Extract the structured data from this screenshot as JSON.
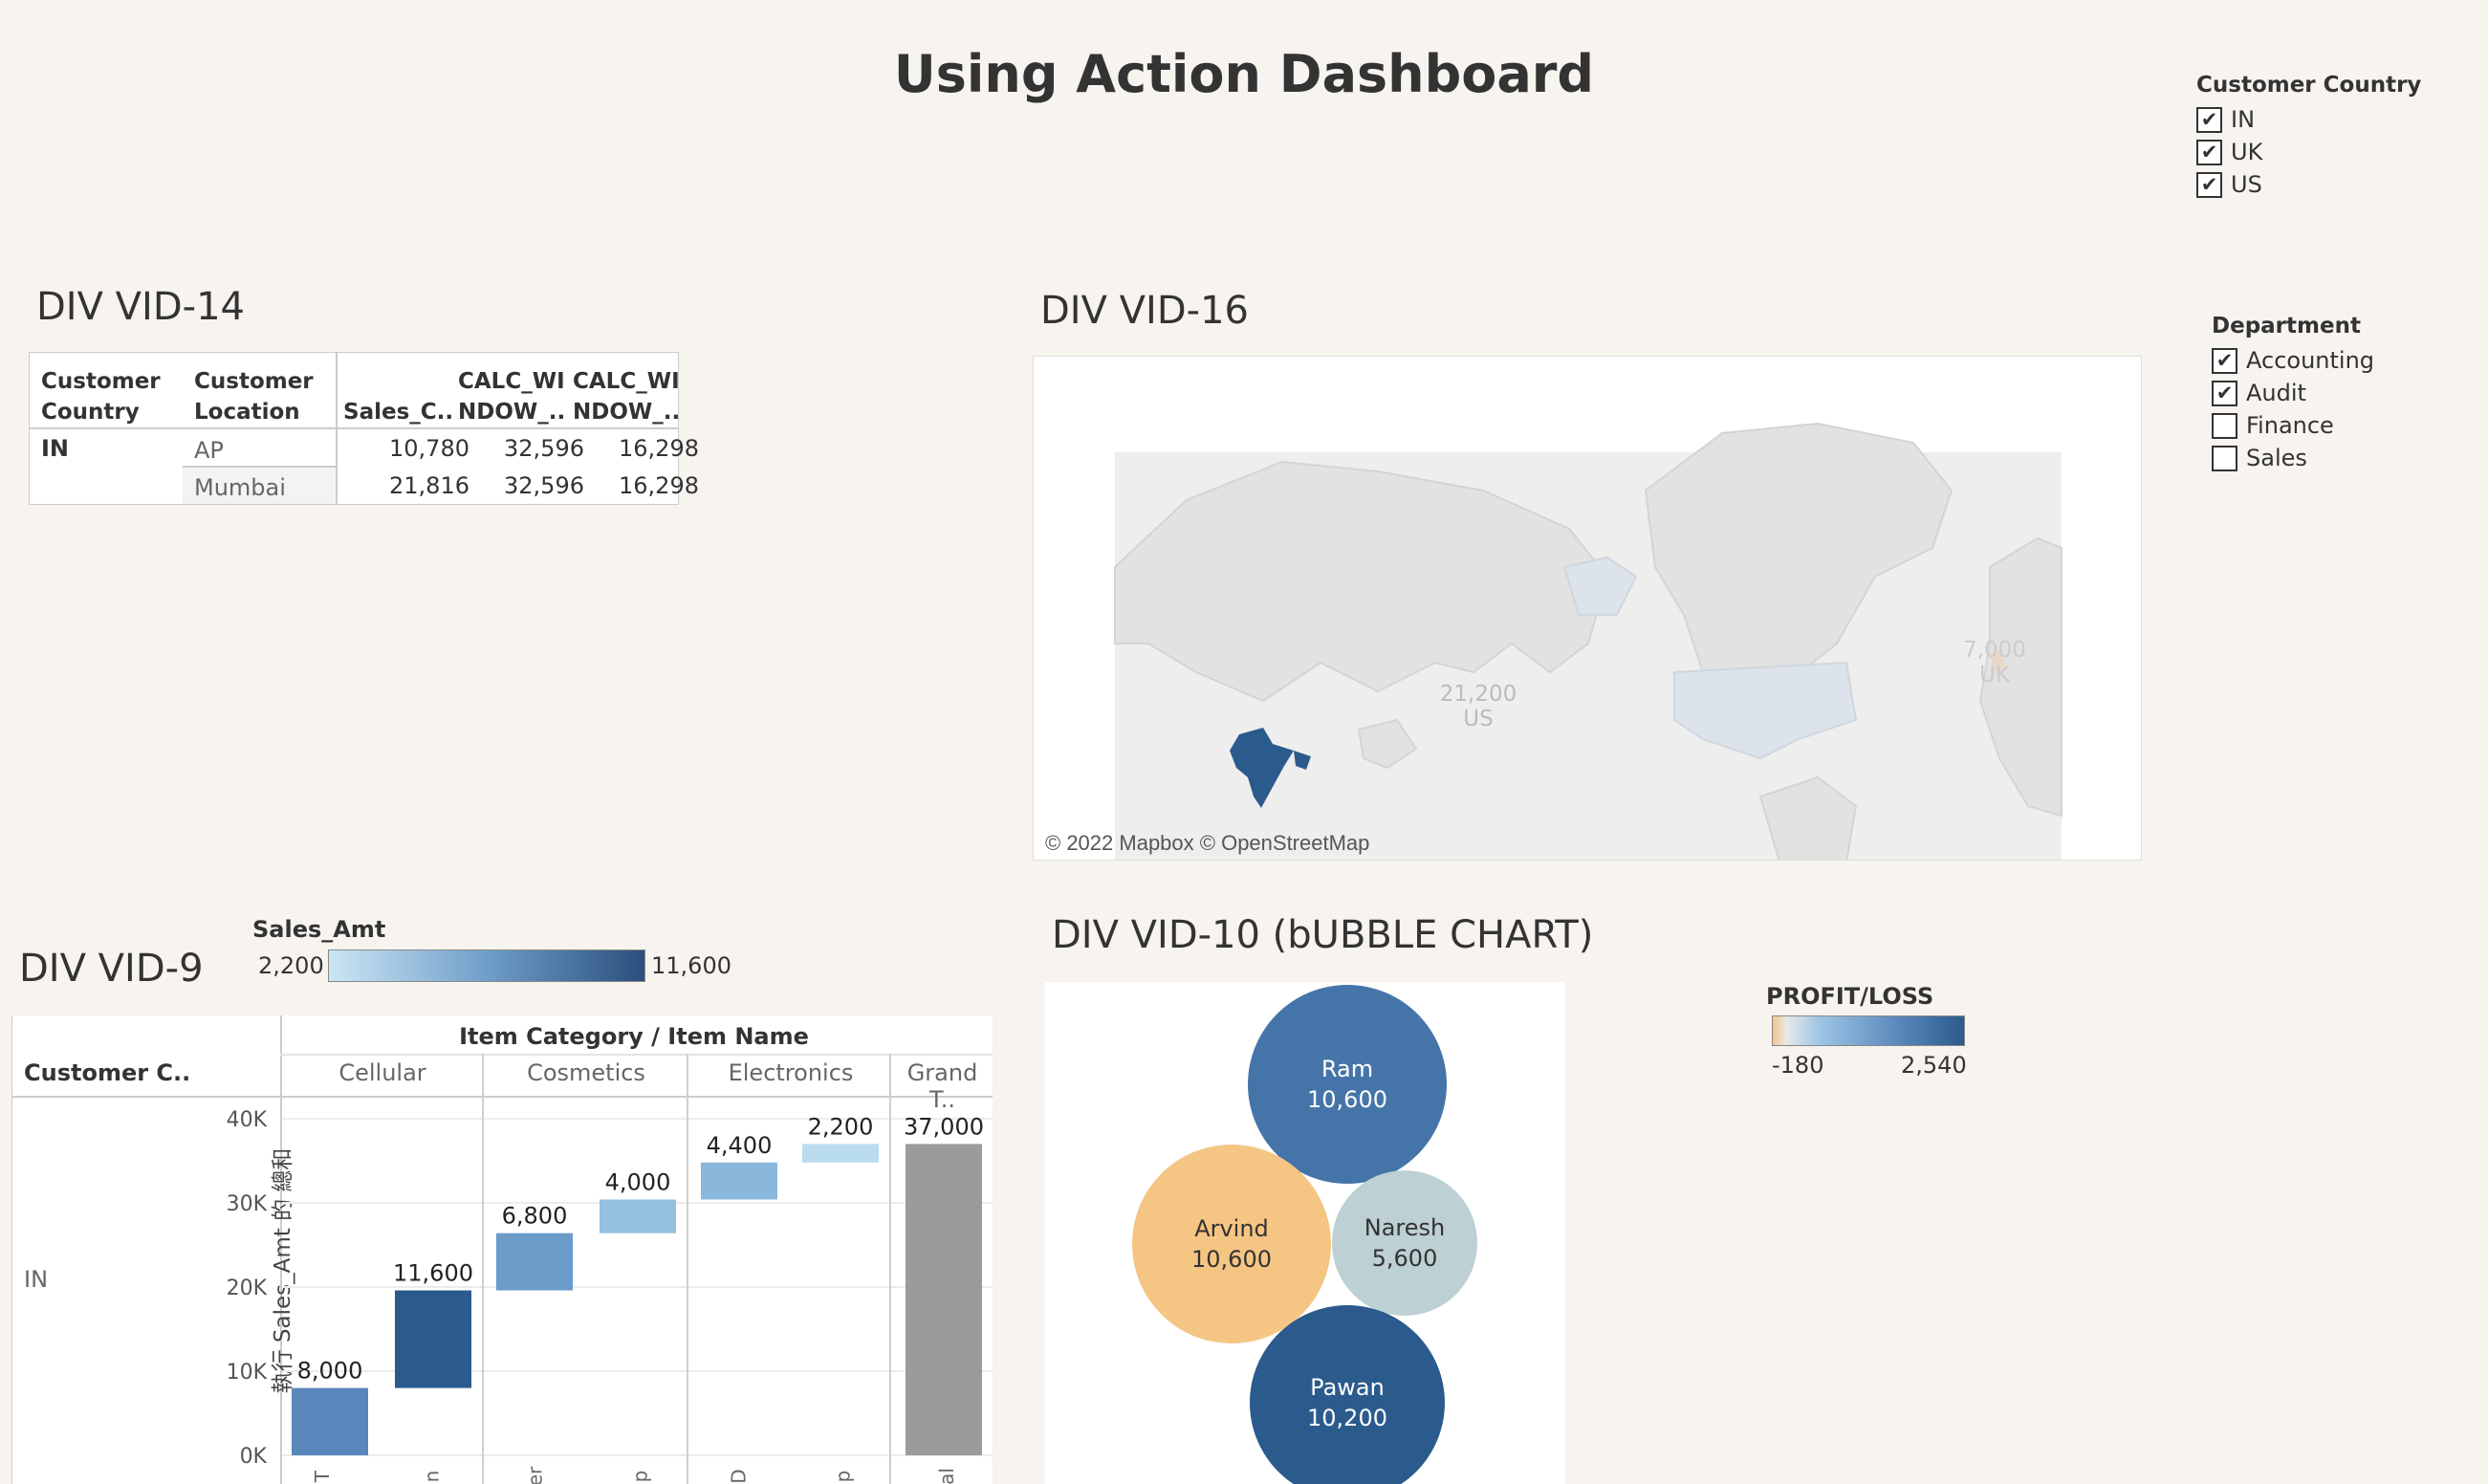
{
  "dashboard": {
    "title": "Using Action Dashboard"
  },
  "filters": {
    "customer_country": {
      "title": "Customer Country",
      "options": [
        {
          "label": "IN",
          "checked": true
        },
        {
          "label": "UK",
          "checked": true
        },
        {
          "label": "US",
          "checked": true
        }
      ]
    },
    "department": {
      "title": "Department",
      "options": [
        {
          "label": "Accounting",
          "checked": true
        },
        {
          "label": "Audit",
          "checked": true
        },
        {
          "label": "Finance",
          "checked": false
        },
        {
          "label": "Sales",
          "checked": false
        }
      ]
    }
  },
  "vid14": {
    "title": "DIV VID-14",
    "headers": {
      "country_1": "Customer",
      "country_2": "Country",
      "location_1": "Customer",
      "location_2": "Location",
      "sales": "Sales_C..",
      "calc1_1": "CALC_WI",
      "calc1_2": "NDOW_..",
      "calc2_1": "CALC_WI",
      "calc2_2": "NDOW_.."
    },
    "country": "IN",
    "rows": [
      {
        "location": "AP",
        "sales": "10,780",
        "calc1": "32,596",
        "calc2": "16,298"
      },
      {
        "location": "Mumbai",
        "sales": "21,816",
        "calc1": "32,596",
        "calc2": "16,298"
      }
    ]
  },
  "vid16": {
    "title": "DIV VID-16",
    "attribution": "© 2022 Mapbox © OpenStreetMap",
    "markers": [
      {
        "value": "21,200",
        "country": "US"
      },
      {
        "value": "7,000",
        "country": "UK"
      }
    ],
    "colors": {
      "in": "#2b5b8c",
      "us": "#dde3ea",
      "uk": "#e8d9c4",
      "land": "#e8e8e8"
    }
  },
  "vid9": {
    "title": "DIV VID-9",
    "legend": {
      "title": "Sales_Amt",
      "min": "2,200",
      "max": "11,600"
    },
    "header": "Item Category  /  Item Name",
    "row_header": "Customer C..",
    "row_value": "IN",
    "yaxis_label": "執行 Sales_Amt 的 總和",
    "categories": [
      "Cellular",
      "Cosmetics",
      "Electronics",
      "Grand T.."
    ],
    "item_stubs": [
      "T",
      "n",
      "er",
      "p",
      "D",
      "p",
      "al"
    ]
  },
  "chart_data": [
    {
      "type": "bar",
      "title": "DIV VID-9",
      "subtype": "waterfall",
      "ylabel": "執行 Sales_Amt 的 總和",
      "ylim": [
        0,
        40000
      ],
      "yticks": [
        "0K",
        "10K",
        "20K",
        "30K",
        "40K"
      ],
      "category_groups": [
        "Cellular",
        "Cellular",
        "Cosmetics",
        "Cosmetics",
        "Electronics",
        "Electronics",
        "Grand T.."
      ],
      "values": [
        8000,
        11600,
        6800,
        4000,
        4400,
        2200,
        37000
      ],
      "labels": [
        "8,000",
        "11,600",
        "6,800",
        "4,000",
        "4,400",
        "2,200",
        "37,000"
      ],
      "colors": [
        "#5987bb",
        "#2b5b8c",
        "#6b9bc8",
        "#95c0e0",
        "#8ab8dd",
        "#b9dcf0",
        "#9b9b9b"
      ]
    },
    {
      "type": "bubble",
      "title": "DIV VID-10 (bUBBLE CHART)",
      "legend": {
        "title": "PROFIT/LOSS",
        "min": "-180",
        "max": "2,540"
      },
      "bubbles": [
        {
          "name": "Ram",
          "value": 10600,
          "label": "10,600",
          "color": "#4575a8",
          "text_color": "#ffffff"
        },
        {
          "name": "Arvind",
          "value": 10600,
          "label": "10,600",
          "color": "#f5c583",
          "text_color": "#333333"
        },
        {
          "name": "Naresh",
          "value": 5600,
          "label": "5,600",
          "color": "#bdd0d4",
          "text_color": "#333333"
        },
        {
          "name": "Pawan",
          "value": 10200,
          "label": "10,200",
          "color": "#2b5b8c",
          "text_color": "#ffffff"
        }
      ]
    }
  ]
}
